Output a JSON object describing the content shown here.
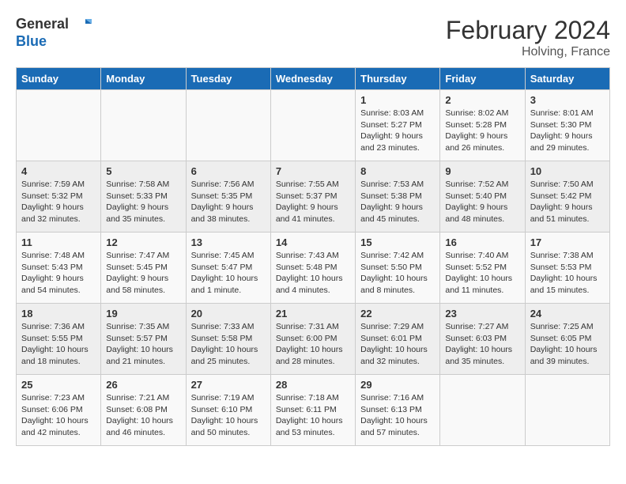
{
  "logo": {
    "line1": "General",
    "line2": "Blue"
  },
  "title": "February 2024",
  "subtitle": "Holving, France",
  "headers": [
    "Sunday",
    "Monday",
    "Tuesday",
    "Wednesday",
    "Thursday",
    "Friday",
    "Saturday"
  ],
  "weeks": [
    [
      {
        "day": "",
        "content": ""
      },
      {
        "day": "",
        "content": ""
      },
      {
        "day": "",
        "content": ""
      },
      {
        "day": "",
        "content": ""
      },
      {
        "day": "1",
        "content": "Sunrise: 8:03 AM\nSunset: 5:27 PM\nDaylight: 9 hours\nand 23 minutes."
      },
      {
        "day": "2",
        "content": "Sunrise: 8:02 AM\nSunset: 5:28 PM\nDaylight: 9 hours\nand 26 minutes."
      },
      {
        "day": "3",
        "content": "Sunrise: 8:01 AM\nSunset: 5:30 PM\nDaylight: 9 hours\nand 29 minutes."
      }
    ],
    [
      {
        "day": "4",
        "content": "Sunrise: 7:59 AM\nSunset: 5:32 PM\nDaylight: 9 hours\nand 32 minutes."
      },
      {
        "day": "5",
        "content": "Sunrise: 7:58 AM\nSunset: 5:33 PM\nDaylight: 9 hours\nand 35 minutes."
      },
      {
        "day": "6",
        "content": "Sunrise: 7:56 AM\nSunset: 5:35 PM\nDaylight: 9 hours\nand 38 minutes."
      },
      {
        "day": "7",
        "content": "Sunrise: 7:55 AM\nSunset: 5:37 PM\nDaylight: 9 hours\nand 41 minutes."
      },
      {
        "day": "8",
        "content": "Sunrise: 7:53 AM\nSunset: 5:38 PM\nDaylight: 9 hours\nand 45 minutes."
      },
      {
        "day": "9",
        "content": "Sunrise: 7:52 AM\nSunset: 5:40 PM\nDaylight: 9 hours\nand 48 minutes."
      },
      {
        "day": "10",
        "content": "Sunrise: 7:50 AM\nSunset: 5:42 PM\nDaylight: 9 hours\nand 51 minutes."
      }
    ],
    [
      {
        "day": "11",
        "content": "Sunrise: 7:48 AM\nSunset: 5:43 PM\nDaylight: 9 hours\nand 54 minutes."
      },
      {
        "day": "12",
        "content": "Sunrise: 7:47 AM\nSunset: 5:45 PM\nDaylight: 9 hours\nand 58 minutes."
      },
      {
        "day": "13",
        "content": "Sunrise: 7:45 AM\nSunset: 5:47 PM\nDaylight: 10 hours\nand 1 minute."
      },
      {
        "day": "14",
        "content": "Sunrise: 7:43 AM\nSunset: 5:48 PM\nDaylight: 10 hours\nand 4 minutes."
      },
      {
        "day": "15",
        "content": "Sunrise: 7:42 AM\nSunset: 5:50 PM\nDaylight: 10 hours\nand 8 minutes."
      },
      {
        "day": "16",
        "content": "Sunrise: 7:40 AM\nSunset: 5:52 PM\nDaylight: 10 hours\nand 11 minutes."
      },
      {
        "day": "17",
        "content": "Sunrise: 7:38 AM\nSunset: 5:53 PM\nDaylight: 10 hours\nand 15 minutes."
      }
    ],
    [
      {
        "day": "18",
        "content": "Sunrise: 7:36 AM\nSunset: 5:55 PM\nDaylight: 10 hours\nand 18 minutes."
      },
      {
        "day": "19",
        "content": "Sunrise: 7:35 AM\nSunset: 5:57 PM\nDaylight: 10 hours\nand 21 minutes."
      },
      {
        "day": "20",
        "content": "Sunrise: 7:33 AM\nSunset: 5:58 PM\nDaylight: 10 hours\nand 25 minutes."
      },
      {
        "day": "21",
        "content": "Sunrise: 7:31 AM\nSunset: 6:00 PM\nDaylight: 10 hours\nand 28 minutes."
      },
      {
        "day": "22",
        "content": "Sunrise: 7:29 AM\nSunset: 6:01 PM\nDaylight: 10 hours\nand 32 minutes."
      },
      {
        "day": "23",
        "content": "Sunrise: 7:27 AM\nSunset: 6:03 PM\nDaylight: 10 hours\nand 35 minutes."
      },
      {
        "day": "24",
        "content": "Sunrise: 7:25 AM\nSunset: 6:05 PM\nDaylight: 10 hours\nand 39 minutes."
      }
    ],
    [
      {
        "day": "25",
        "content": "Sunrise: 7:23 AM\nSunset: 6:06 PM\nDaylight: 10 hours\nand 42 minutes."
      },
      {
        "day": "26",
        "content": "Sunrise: 7:21 AM\nSunset: 6:08 PM\nDaylight: 10 hours\nand 46 minutes."
      },
      {
        "day": "27",
        "content": "Sunrise: 7:19 AM\nSunset: 6:10 PM\nDaylight: 10 hours\nand 50 minutes."
      },
      {
        "day": "28",
        "content": "Sunrise: 7:18 AM\nSunset: 6:11 PM\nDaylight: 10 hours\nand 53 minutes."
      },
      {
        "day": "29",
        "content": "Sunrise: 7:16 AM\nSunset: 6:13 PM\nDaylight: 10 hours\nand 57 minutes."
      },
      {
        "day": "",
        "content": ""
      },
      {
        "day": "",
        "content": ""
      }
    ]
  ]
}
